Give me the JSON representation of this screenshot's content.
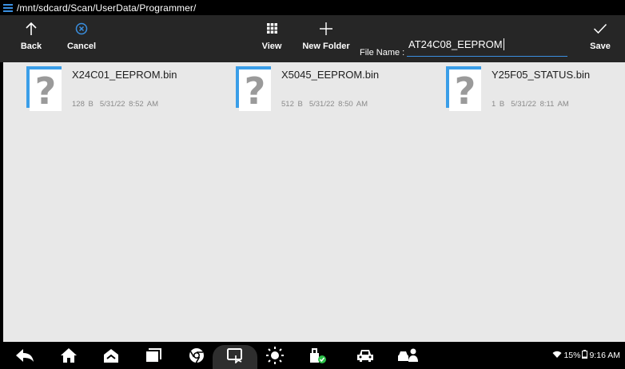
{
  "pathbar": {
    "path": "/mnt/sdcard/Scan/UserData/Programmer/",
    "menu_icon": "menu-icon"
  },
  "toolbar": {
    "back_label": "Back",
    "cancel_label": "Cancel",
    "view_label": "View",
    "new_folder_label": "New Folder",
    "file_name_label": "File Name :",
    "file_name_value": "AT24C08_EEPROM",
    "save_label": "Save"
  },
  "files": [
    {
      "name": "X24C01_EEPROM.bin",
      "size": "128 B",
      "date": "5/31/22 8:52 AM"
    },
    {
      "name": "X5045_EEPROM.bin",
      "size": "512 B",
      "date": "5/31/22 8:50 AM"
    },
    {
      "name": "Y25F05_STATUS.bin",
      "size": "1 B",
      "date": "5/31/22 8:11 AM"
    }
  ],
  "status": {
    "battery": "15%",
    "time": "9:16 AM"
  },
  "nav_icons": [
    "back-arrow-icon",
    "home-icon",
    "scan-home-icon",
    "recent-apps-icon",
    "browser-icon",
    "screenshot-icon",
    "brightness-icon",
    "vci-icon",
    "car-icon",
    "remote-support-icon"
  ],
  "colors": {
    "accent": "#3a8fe0",
    "toolbar": "#262626",
    "content_bg": "#e8e8e8",
    "file_icon_border": "#3a9ee8"
  }
}
